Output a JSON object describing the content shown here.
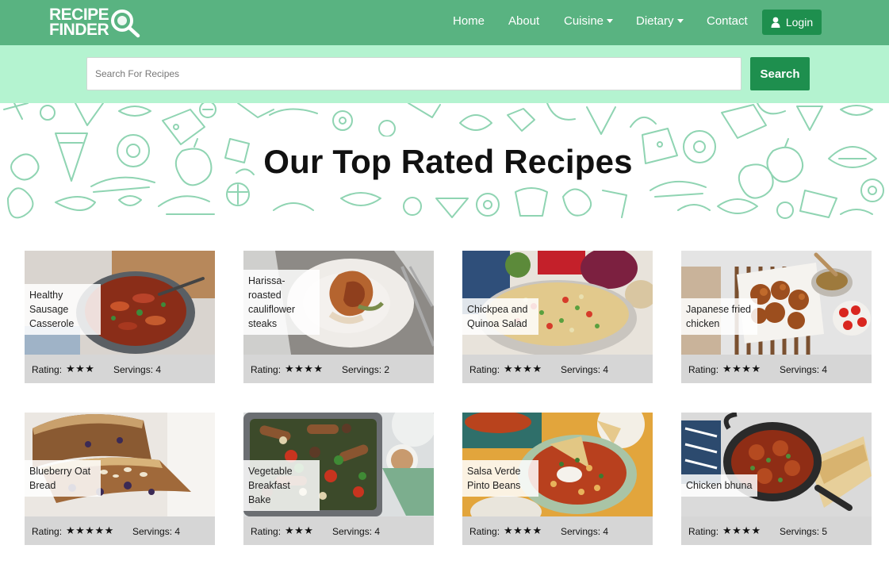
{
  "brand": {
    "line1": "RECIPE",
    "line2": "FINDER"
  },
  "nav": {
    "home": "Home",
    "about": "About",
    "cuisine": "Cuisine",
    "dietary": "Dietary",
    "contact": "Contact",
    "login": "Login"
  },
  "search": {
    "placeholder": "Search For Recipes",
    "button": "Search"
  },
  "hero": {
    "title": "Our Top Rated Recipes"
  },
  "colors": {
    "nav": "#59b381",
    "accent": "#1e8f4e",
    "search_band": "#b4f3d0",
    "pattern": "#8fd4b2"
  },
  "labels": {
    "rating": "Rating:"
  },
  "recipes": [
    {
      "name": "Healthy Sausage Casserole",
      "stars": "★★★",
      "servings": "Servings: 4"
    },
    {
      "name": "Harissa-roasted cauliflower steaks",
      "stars": "★★★★",
      "servings": "Servings: 2"
    },
    {
      "name": "Chickpea and Quinoa Salad",
      "stars": "★★★★",
      "servings": "Servings: 4"
    },
    {
      "name": "Japanese fried chicken",
      "stars": "★★★★",
      "servings": "Servings: 4"
    },
    {
      "name": "Blueberry Oat Bread",
      "stars": "★★★★★",
      "servings": "Servings: 4"
    },
    {
      "name": "Vegetable Breakfast Bake",
      "stars": "★★★",
      "servings": "Servings: 4"
    },
    {
      "name": "Salsa Verde Pinto Beans",
      "stars": "★★★★",
      "servings": "Servings: 4"
    },
    {
      "name": "Chicken bhuna",
      "stars": "★★★★",
      "servings": "Servings: 5"
    }
  ]
}
